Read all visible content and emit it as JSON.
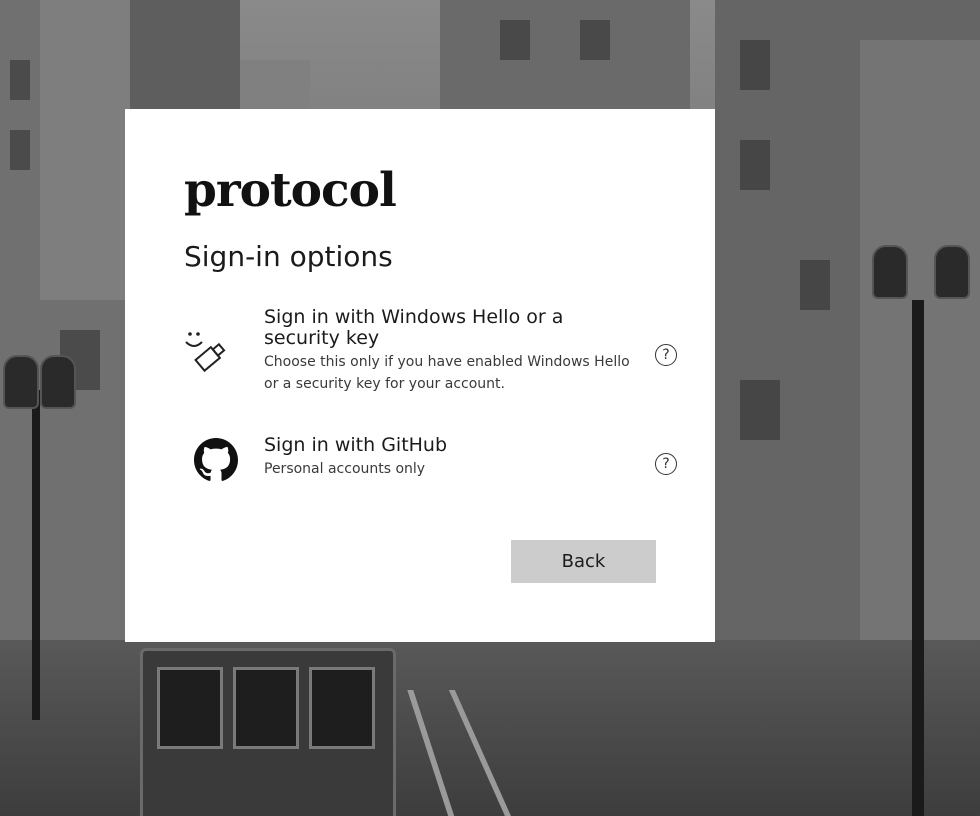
{
  "brand": {
    "logo": "protocol"
  },
  "dialog": {
    "title": "Sign-in options",
    "options": [
      {
        "title": "Sign in with Windows Hello or a security key",
        "description": "Choose this only if you have enabled Windows Hello or a security key for your account.",
        "icon": "windows-hello-key-icon"
      },
      {
        "title": "Sign in with GitHub",
        "description": "Personal accounts only",
        "icon": "github-icon"
      }
    ],
    "help_glyph": "?",
    "back_label": "Back"
  },
  "colors": {
    "dialog_bg": "#ffffff",
    "button_bg": "#cccccc",
    "text": "#1b1b1b"
  }
}
